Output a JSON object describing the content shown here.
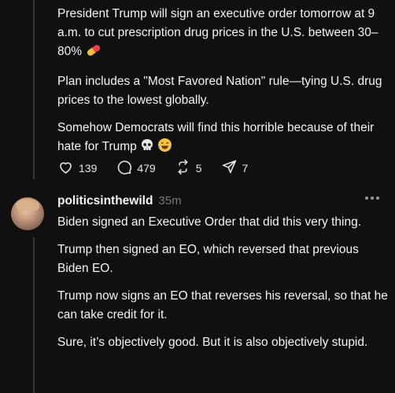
{
  "post1": {
    "paragraphs": [
      "President Trump will sign an executive order tomorrow at 9 a.m. to cut prescription drug prices in the U.S. between 30–80%",
      "Plan includes a \"Most Favored Nation\" rule—tying U.S. drug prices to the lowest globally.",
      "Somehow Democrats will find this horrible because of their hate for Trump"
    ],
    "actions": {
      "likes": "139",
      "replies": "479",
      "reposts": "5",
      "shares": "7"
    }
  },
  "reply": {
    "username": "politicsinthewild",
    "timestamp": "35m",
    "paragraphs": [
      "Biden signed an Executive Order that did this very thing.",
      "Trump then signed an EO, which reversed that previous Biden EO.",
      "Trump now signs an EO that reverses his reversal, so that he can take credit for it.",
      "Sure, it’s objectively good. But it is also objectively stupid."
    ]
  },
  "icons": [
    "pill-emoji",
    "skull-emoji",
    "laughing-tears-emoji",
    "heart-icon",
    "comment-icon",
    "repost-icon",
    "share-icon",
    "more-icon"
  ]
}
